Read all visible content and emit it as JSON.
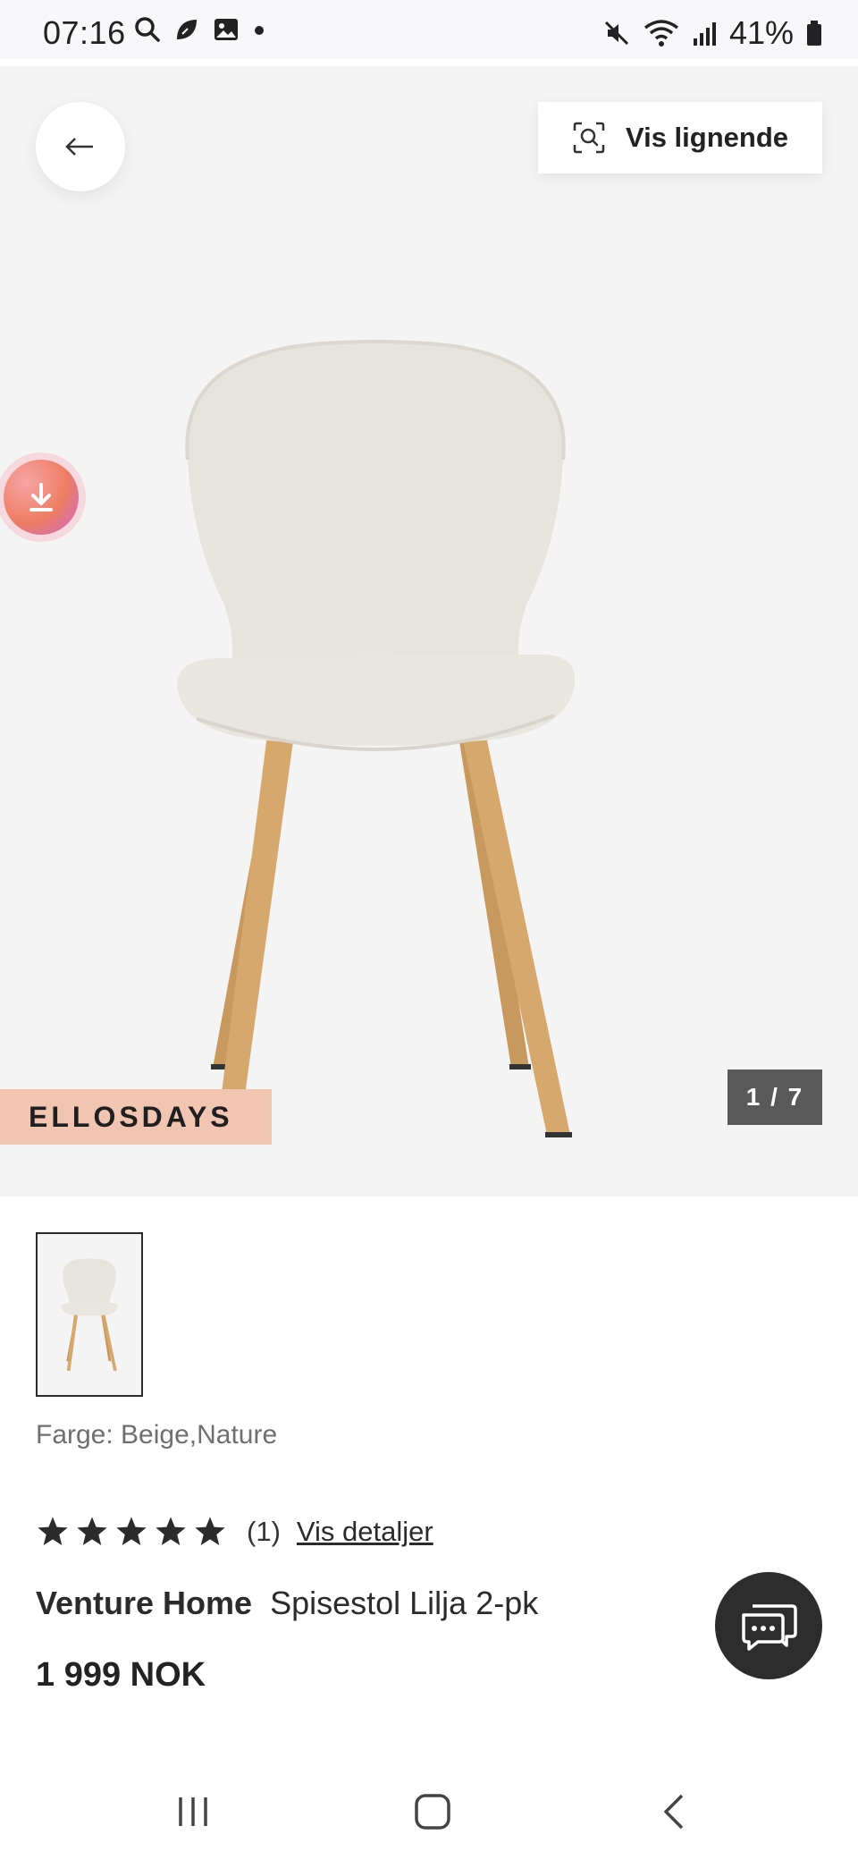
{
  "status_bar": {
    "time": "07:16",
    "battery_percent": "41%",
    "icons_left": [
      "search-icon",
      "leaf-icon",
      "gallery-icon",
      "dot-icon"
    ],
    "icons_right": [
      "mute-icon",
      "wifi-icon",
      "signal-icon",
      "battery-icon"
    ]
  },
  "hero": {
    "back_icon": "arrow-left-icon",
    "similar_button_label": "Vis lignende",
    "similar_icon": "visual-search-icon",
    "download_icon": "download-icon",
    "campaign_badge": "ELLOSDAYS",
    "image_counter": "1 / 7"
  },
  "product": {
    "color_line": "Farge: Beige,Nature",
    "rating_stars": 5,
    "rating_count": "(1)",
    "details_link": "Vis detaljer",
    "brand": "Venture Home",
    "name": "Spisestol Lilja 2-pk",
    "price": "1 999 NOK"
  },
  "chat": {
    "icon": "chat-bubbles-icon"
  },
  "nav_bar": {
    "buttons": [
      "recents-icon",
      "home-icon",
      "back-icon"
    ]
  },
  "colors": {
    "hero_bg": "#f4f4f4",
    "badge_bg": "#f2c4b2",
    "counter_bg": "#595959",
    "chat_bg": "#2d2d2d",
    "text": "#2b2b2b",
    "chair_fabric": "#e7e3dd",
    "chair_wood": "#d2a36a"
  }
}
